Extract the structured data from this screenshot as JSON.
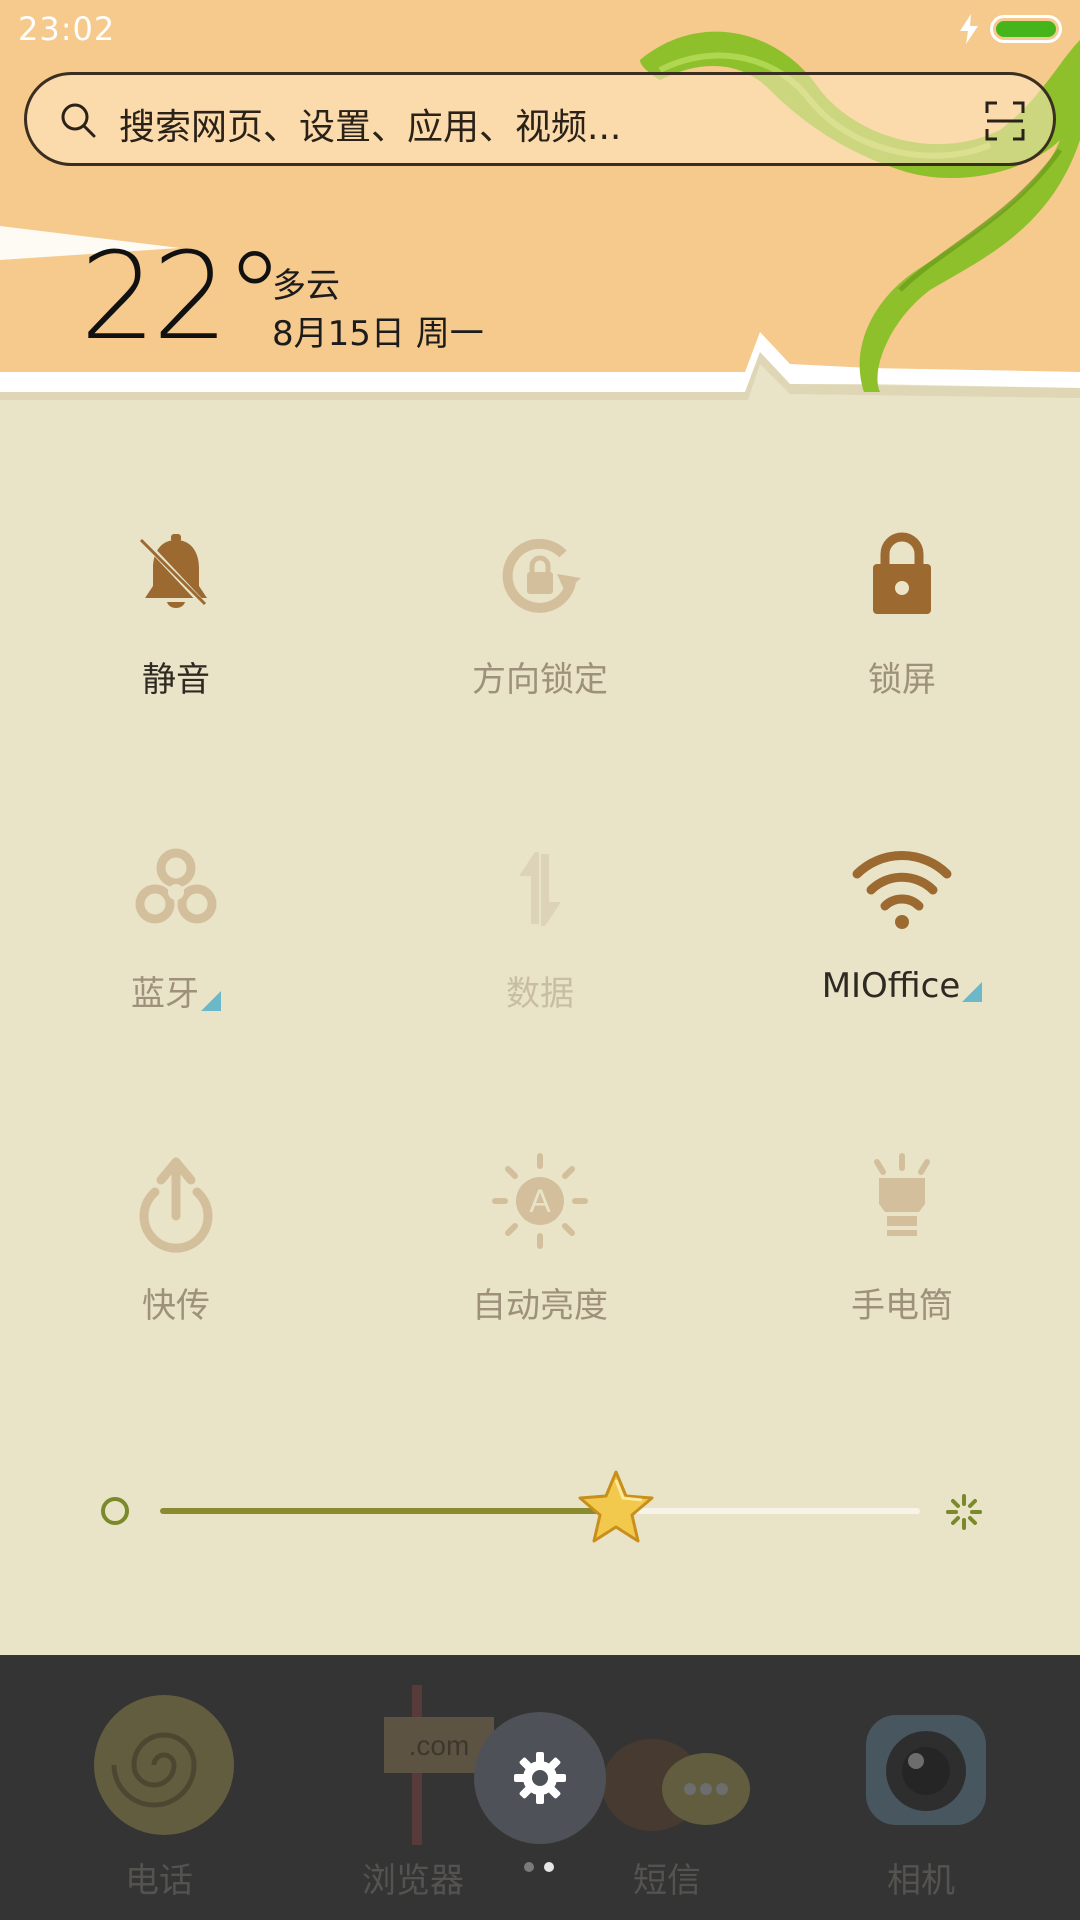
{
  "status_bar": {
    "time": "23:02",
    "charging": true,
    "battery_level": 1.0,
    "battery_color": "#45b51b"
  },
  "search": {
    "placeholder": "搜索网页、设置、应用、视频..."
  },
  "weather": {
    "temperature": "22°",
    "condition": "多云",
    "date": "8月15日 周一"
  },
  "toggles": [
    {
      "id": "silent",
      "label": "静音",
      "icon": "bell-off-icon",
      "state": "on"
    },
    {
      "id": "rotation-lock",
      "label": "方向锁定",
      "icon": "rotation-lock-icon",
      "state": "off"
    },
    {
      "id": "lock-screen",
      "label": "锁屏",
      "icon": "padlock-icon",
      "state": "on"
    },
    {
      "id": "bluetooth",
      "label": "蓝牙",
      "icon": "bluetooth-icon",
      "state": "off",
      "has_menu": true
    },
    {
      "id": "mobile-data",
      "label": "数据",
      "icon": "data-arrows-icon",
      "state": "disabled"
    },
    {
      "id": "wifi",
      "label": "MIOffice",
      "icon": "wifi-icon",
      "state": "on",
      "has_menu": true
    },
    {
      "id": "quick-share",
      "label": "快传",
      "icon": "share-upload-icon",
      "state": "off"
    },
    {
      "id": "auto-brightness",
      "label": "自动亮度",
      "icon": "auto-brightness-icon",
      "state": "off"
    },
    {
      "id": "flashlight",
      "label": "手电筒",
      "icon": "flashlight-icon",
      "state": "off"
    }
  ],
  "brightness": {
    "level": 0.6,
    "low_icon": "brightness-low-icon",
    "high_icon": "brightness-high-icon",
    "thumb_icon": "star-icon"
  },
  "dock": {
    "apps": [
      {
        "label": "电话",
        "icon": "phone-shell-icon"
      },
      {
        "label": "浏览器",
        "icon": "browser-sign-icon"
      },
      {
        "label": "短信",
        "icon": "message-coconut-icon"
      },
      {
        "label": "相机",
        "icon": "camera-icon"
      }
    ],
    "settings_icon": "gear-icon",
    "page_count": 2,
    "current_page": 2
  },
  "colors": {
    "header_orange": "#f6c98c",
    "panel_cream": "#e9e4c8",
    "icon_active_brown": "#9c6a30",
    "icon_inactive_tan": "#cdb793",
    "leaf_green": "#8ec02c"
  }
}
